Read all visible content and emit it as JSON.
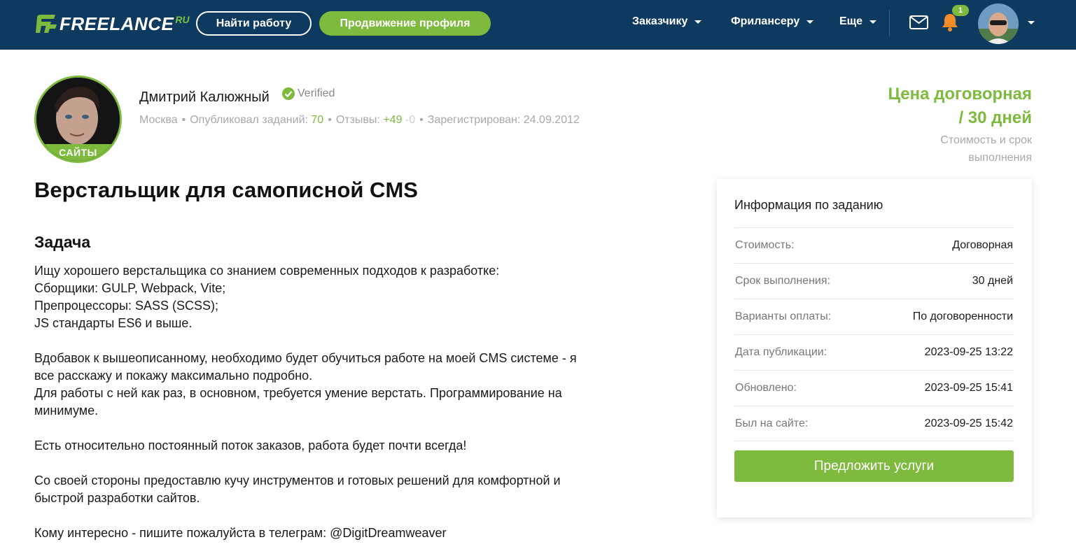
{
  "header": {
    "logo_text": "FREELANCE",
    "logo_suffix": "RU",
    "find_work": "Найти работу",
    "promo": "Продвижение профиля",
    "nav": [
      "Заказчику",
      "Фрилансеру",
      "Еще"
    ],
    "notification_count": "1"
  },
  "author": {
    "name": "Дмитрий Калюжный",
    "verified": "Verified",
    "badge": "САЙТЫ",
    "city": "Москва",
    "published_label": "Опубликовал заданий:",
    "published_count": "70",
    "reviews_label": "Отзывы:",
    "reviews_pos": "+49",
    "reviews_neg": "-0",
    "registered": "Зарегистрирован: 24.09.2012"
  },
  "price": {
    "line1": "Цена договорная",
    "line2": "/ 30 дней",
    "sub1": "Стоимость и срок",
    "sub2": "выполнения"
  },
  "job": {
    "title": "Верстальщик для самописной CMS",
    "section": "Задача",
    "paragraphs": [
      [
        "Ищу хорошего верстальщика со знанием современных подходов к разработке:",
        "Сборщики: GULP, Webpack, Vite;",
        "Препроцессоры: SASS (SCSS);",
        "JS стандарты ES6 и выше."
      ],
      [
        "Вдобавок к вышеописанному, необходимо будет обучиться работе на моей CMS системе - я",
        "все расскажу и покажу максимально подробно.",
        "Для работы с ней как раз, в основном, требуется умение верстать. Программирование на",
        "минимуме."
      ],
      [
        "Есть относительно постоянный поток заказов, работа будет почти всегда!"
      ],
      [
        "Со своей стороны предоставлю кучу инструментов и готовых решений для комфортной и",
        "быстрой разработки сайтов."
      ],
      [
        "Кому интересно - пишите пожалуйста в телеграм: @DigitDreamweaver"
      ]
    ]
  },
  "info": {
    "title": "Информация по заданию",
    "rows": [
      {
        "label": "Стоимость:",
        "value": "Договорная"
      },
      {
        "label": "Срок выполнения:",
        "value": "30 дней"
      },
      {
        "label": "Варианты оплаты:",
        "value": "По договоренности"
      },
      {
        "label": "Дата публикации:",
        "value": "2023-09-25 13:22"
      },
      {
        "label": "Обновлено:",
        "value": "2023-09-25 15:41"
      },
      {
        "label": "Был на сайте:",
        "value": "2023-09-25 15:42"
      }
    ],
    "button": "Предложить услуги"
  },
  "colors": {
    "header_bg": "#0f3a5f",
    "accent_green": "#7dba3e",
    "bell": "#f28c28"
  }
}
